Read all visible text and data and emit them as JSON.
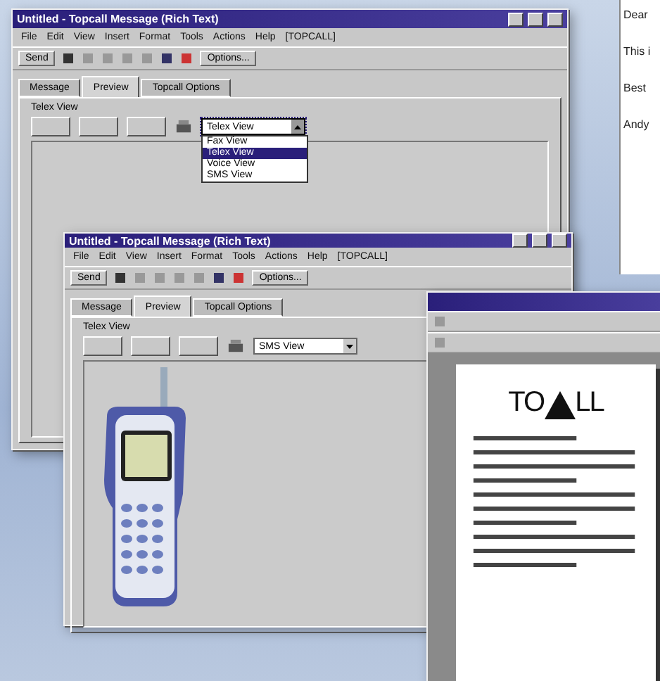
{
  "letter": {
    "lines": [
      "Dear",
      "This i",
      "Best",
      "Andy"
    ]
  },
  "windows": [
    {
      "kind": "editor",
      "title": "Untitled - Topcall Message (Rich Text)",
      "menu": [
        "File",
        "Edit",
        "View",
        "Insert",
        "Format",
        "Tools",
        "Actions",
        "Help",
        "[TOPCALL]"
      ],
      "toolbar": {
        "send": "Send",
        "options": "Options..."
      },
      "tabs": [
        {
          "label": "Message",
          "selected": false
        },
        {
          "label": "Preview",
          "selected": true
        },
        {
          "label": "Topcall Options",
          "selected": false
        }
      ],
      "group_label": "Telex View",
      "view_select": {
        "value": "Telex View",
        "expanded": true,
        "options": [
          {
            "label": "Fax View",
            "selected": false
          },
          {
            "label": "Telex View",
            "selected": true
          },
          {
            "label": "Voice View",
            "selected": false
          },
          {
            "label": "SMS View",
            "selected": false
          }
        ]
      }
    },
    {
      "kind": "editor",
      "title": "Untitled - Topcall Message (Rich Text)",
      "menu": [
        "File",
        "Edit",
        "View",
        "Insert",
        "Format",
        "Tools",
        "Actions",
        "Help",
        "[TOPCALL]"
      ],
      "toolbar": {
        "send": "Send",
        "options": "Options..."
      },
      "tabs": [
        {
          "label": "Message",
          "selected": false
        },
        {
          "label": "Preview",
          "selected": true
        },
        {
          "label": "Topcall Options",
          "selected": false
        }
      ],
      "group_label": "Telex View",
      "view_select": {
        "value": "SMS View",
        "expanded": false
      },
      "preview": {
        "kind": "phone"
      }
    },
    {
      "kind": "document",
      "logo": {
        "left": "TO",
        "right": "LL"
      }
    }
  ]
}
